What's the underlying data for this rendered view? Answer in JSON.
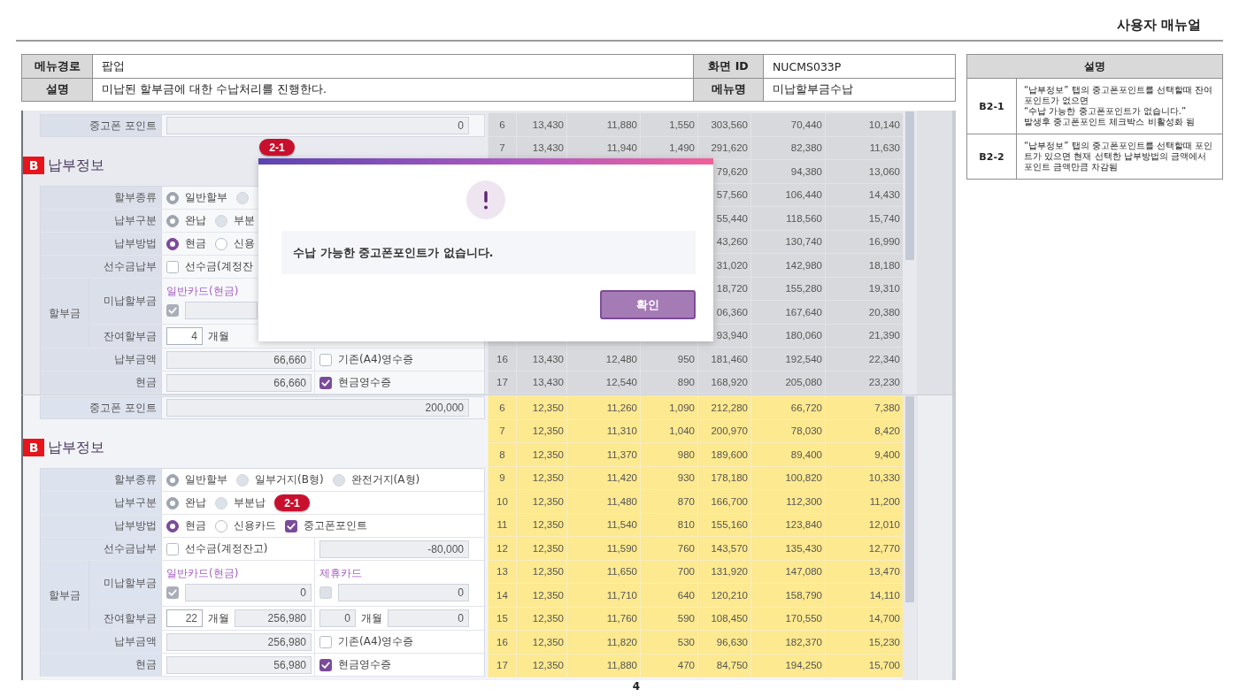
{
  "header": {
    "title": "사용자 매뉴얼"
  },
  "info_table": {
    "rows": [
      {
        "cells": [
          {
            "label": "메뉴경로",
            "value": "팝업"
          },
          {
            "label": "화면 ID",
            "value": "NUCMS033P"
          }
        ]
      },
      {
        "cells": [
          {
            "label": "설명",
            "value": "미납된 할부금에 대한 수납처리를 진행한다."
          },
          {
            "label": "메뉴명",
            "value": "미납할부금수납"
          }
        ]
      }
    ]
  },
  "screens": [
    {
      "dimmed": true,
      "point": {
        "label": "중고폰 포인트",
        "value": "0"
      },
      "section": {
        "badge": "B",
        "title": "납부정보"
      },
      "form": [
        {
          "kind": "row",
          "label": "할부종류",
          "cells": [
            [
              {
                "kind": "radio",
                "label": "일반할부",
                "selected": true,
                "disabled": true
              },
              {
                "kind": "radio",
                "selected": false,
                "disabled": true
              }
            ]
          ]
        },
        {
          "kind": "row",
          "label": "납부구분",
          "cells": [
            [
              {
                "kind": "radio",
                "label": "완납",
                "selected": true,
                "disabled": true
              },
              {
                "kind": "radio",
                "label": "부분",
                "selected": false,
                "disabled": true
              }
            ]
          ]
        },
        {
          "kind": "row",
          "label": "납부방법",
          "cells": [
            [
              {
                "kind": "radio",
                "label": "현금",
                "selected": true,
                "disabled": false
              },
              {
                "kind": "radio",
                "label": "신용",
                "selected": false,
                "disabled": false
              }
            ]
          ]
        },
        {
          "kind": "row",
          "label": "선수금납부",
          "cells": [
            [
              {
                "kind": "checkbox",
                "label": "선수금(계정잔",
                "checked": false,
                "disabled": false
              }
            ]
          ]
        },
        {
          "kind": "group",
          "label": "할부금",
          "children": [
            {
              "label": "미납할부금",
              "cells": [
                [
                  {
                    "kind": "caption",
                    "label": "일반카드(현금)"
                  },
                  {
                    "kind": "checkbox",
                    "checked": true,
                    "disabled": true
                  },
                  {
                    "kind": "field",
                    "readonly": true
                  }
                ]
              ]
            },
            {
              "label": "잔여할부금",
              "cells": [
                [
                  {
                    "kind": "count",
                    "value": "4",
                    "readonly": false
                  },
                  {
                    "kind": "unit",
                    "label": "개월"
                  }
                ]
              ]
            }
          ]
        },
        {
          "kind": "row",
          "label": "납부금액",
          "cells": [
            [
              {
                "kind": "field",
                "value": "66,660",
                "readonly": true
              }
            ],
            [
              {
                "kind": "checkbox",
                "label": "기존(A4)영수증",
                "checked": false,
                "disabled": false
              }
            ]
          ]
        },
        {
          "kind": "row",
          "label": "현금",
          "cells": [
            [
              {
                "kind": "field",
                "value": "66,660",
                "readonly": true
              }
            ],
            [
              {
                "kind": "checkbox",
                "label": "현금영수증",
                "checked": true,
                "disabled": false
              }
            ]
          ]
        }
      ],
      "table": {
        "rows": [
          [
            "6",
            "13,430",
            "11,880",
            "1,550",
            "303,560",
            "70,440",
            "10,140"
          ],
          [
            "7",
            "13,430",
            "11,940",
            "1,490",
            "291,620",
            "82,380",
            "11,630"
          ],
          [
            null,
            null,
            null,
            null,
            "79,620",
            "94,380",
            "13,060"
          ],
          [
            null,
            null,
            null,
            null,
            "57,560",
            "106,440",
            "14,430"
          ],
          [
            null,
            null,
            null,
            null,
            "55,440",
            "118,560",
            "15,740"
          ],
          [
            null,
            null,
            null,
            null,
            "43,260",
            "130,740",
            "16,990"
          ],
          [
            null,
            null,
            null,
            null,
            "31,020",
            "142,980",
            "18,180"
          ],
          [
            null,
            null,
            null,
            null,
            "18,720",
            "155,280",
            "19,310"
          ],
          [
            null,
            null,
            null,
            null,
            "06,360",
            "167,640",
            "20,380"
          ],
          [
            null,
            null,
            null,
            null,
            "93,940",
            "180,060",
            "21,390"
          ],
          [
            "16",
            "13,430",
            "12,480",
            "950",
            "181,460",
            "192,540",
            "22,340"
          ],
          [
            "17",
            "13,430",
            "12,540",
            "890",
            "168,920",
            "205,080",
            "23,230"
          ]
        ]
      },
      "dialog": {
        "badge": "2-1",
        "message": "수납 가능한 중고폰포인트가 없습니다.",
        "button": "확인"
      }
    },
    {
      "dimmed": false,
      "point": {
        "label": "중고폰 포인트",
        "value": "200,000"
      },
      "section": {
        "badge": "B",
        "title": "납부정보"
      },
      "form": [
        {
          "kind": "row",
          "label": "할부종류",
          "cells": [
            [
              {
                "kind": "radio",
                "label": "일반할부",
                "selected": true,
                "disabled": true
              },
              {
                "kind": "radio",
                "label": "일부거지(B형)",
                "selected": false,
                "disabled": true
              },
              {
                "kind": "radio",
                "label": "완전거지(A형)",
                "selected": false,
                "disabled": true
              }
            ]
          ]
        },
        {
          "kind": "row",
          "label": "납부구분",
          "cells": [
            [
              {
                "kind": "radio",
                "label": "완납",
                "selected": true,
                "disabled": true
              },
              {
                "kind": "radio",
                "label": "부분납",
                "selected": false,
                "disabled": true
              },
              {
                "kind": "badge",
                "label": "2-1"
              }
            ]
          ]
        },
        {
          "kind": "row",
          "label": "납부방법",
          "cells": [
            [
              {
                "kind": "radio",
                "label": "현금",
                "selected": true,
                "disabled": false
              },
              {
                "kind": "radio",
                "label": "신용카드",
                "selected": false,
                "disabled": false
              },
              {
                "kind": "checkbox",
                "label": "중고폰포인트",
                "checked": true,
                "disabled": false
              }
            ]
          ]
        },
        {
          "kind": "row",
          "label": "선수금납부",
          "cells": [
            [
              {
                "kind": "checkbox",
                "label": "선수금(계정잔고)",
                "checked": false,
                "disabled": false
              }
            ],
            [
              {
                "kind": "field",
                "value": "-80,000",
                "readonly": true
              }
            ]
          ]
        },
        {
          "kind": "group",
          "label": "할부금",
          "children": [
            {
              "label": "미납할부금",
              "cells": [
                [
                  {
                    "kind": "caption",
                    "label": "일반카드(현금)"
                  },
                  {
                    "kind": "checkbox",
                    "checked": true,
                    "disabled": true
                  },
                  {
                    "kind": "field",
                    "value": "0",
                    "readonly": true
                  }
                ],
                [
                  {
                    "kind": "caption",
                    "label": "제휴카드"
                  },
                  {
                    "kind": "checkbox",
                    "checked": false,
                    "disabled": true
                  },
                  {
                    "kind": "field",
                    "value": "0",
                    "readonly": true
                  }
                ]
              ]
            },
            {
              "label": "잔여할부금",
              "cells": [
                [
                  {
                    "kind": "count",
                    "value": "22",
                    "readonly": false
                  },
                  {
                    "kind": "unit",
                    "label": "개월"
                  },
                  {
                    "kind": "field",
                    "value": "256,980",
                    "readonly": true
                  }
                ],
                [
                  {
                    "kind": "count",
                    "value": "0",
                    "readonly": true
                  },
                  {
                    "kind": "unit",
                    "label": "개월"
                  },
                  {
                    "kind": "field",
                    "value": "0",
                    "readonly": true
                  }
                ]
              ]
            }
          ]
        },
        {
          "kind": "row",
          "label": "납부금액",
          "cells": [
            [
              {
                "kind": "field",
                "value": "256,980",
                "readonly": true
              }
            ],
            [
              {
                "kind": "checkbox",
                "label": "기존(A4)영수증",
                "checked": false,
                "disabled": false
              }
            ]
          ]
        },
        {
          "kind": "row",
          "label": "현금",
          "cells": [
            [
              {
                "kind": "field",
                "value": "56,980",
                "readonly": true
              }
            ],
            [
              {
                "kind": "checkbox",
                "label": "현금영수증",
                "checked": true,
                "disabled": false
              }
            ]
          ]
        }
      ],
      "table": {
        "rows": [
          [
            "6",
            "12,350",
            "11,260",
            "1,090",
            "212,280",
            "66,720",
            "7,380"
          ],
          [
            "7",
            "12,350",
            "11,310",
            "1,040",
            "200,970",
            "78,030",
            "8,420"
          ],
          [
            "8",
            "12,350",
            "11,370",
            "980",
            "189,600",
            "89,400",
            "9,400"
          ],
          [
            "9",
            "12,350",
            "11,420",
            "930",
            "178,180",
            "100,820",
            "10,330"
          ],
          [
            "10",
            "12,350",
            "11,480",
            "870",
            "166,700",
            "112,300",
            "11,200"
          ],
          [
            "11",
            "12,350",
            "11,540",
            "810",
            "155,160",
            "123,840",
            "12,010"
          ],
          [
            "12",
            "12,350",
            "11,590",
            "760",
            "143,570",
            "135,430",
            "12,770"
          ],
          [
            "13",
            "12,350",
            "11,650",
            "700",
            "131,920",
            "147,080",
            "13,470"
          ],
          [
            "14",
            "12,350",
            "11,710",
            "640",
            "120,210",
            "158,790",
            "14,110"
          ],
          [
            "15",
            "12,350",
            "11,760",
            "590",
            "108,450",
            "170,550",
            "14,700"
          ],
          [
            "16",
            "12,350",
            "11,820",
            "530",
            "96,630",
            "182,370",
            "15,230"
          ],
          [
            "17",
            "12,350",
            "11,880",
            "470",
            "84,750",
            "194,250",
            "15,700"
          ]
        ]
      }
    }
  ],
  "description": {
    "title": "설명",
    "rows": [
      {
        "code": "B2-1",
        "text": "“납부정보” 탭의 중고폰포인트를 선택할때 잔여 포인트가 없으면\n“수납 가능한 중고폰포인트가 없습니다.”\n발생후 중고폰포인트 체크박스 비활성화 됨"
      },
      {
        "code": "B2-2",
        "text": "“납부정보” 탭의 중고폰포인트를 선택할때 포인트가 있으면 현재 선택한 납부방법의 금액에서 포인트 금액만큼 차감됨"
      }
    ]
  },
  "page_number": "4"
}
